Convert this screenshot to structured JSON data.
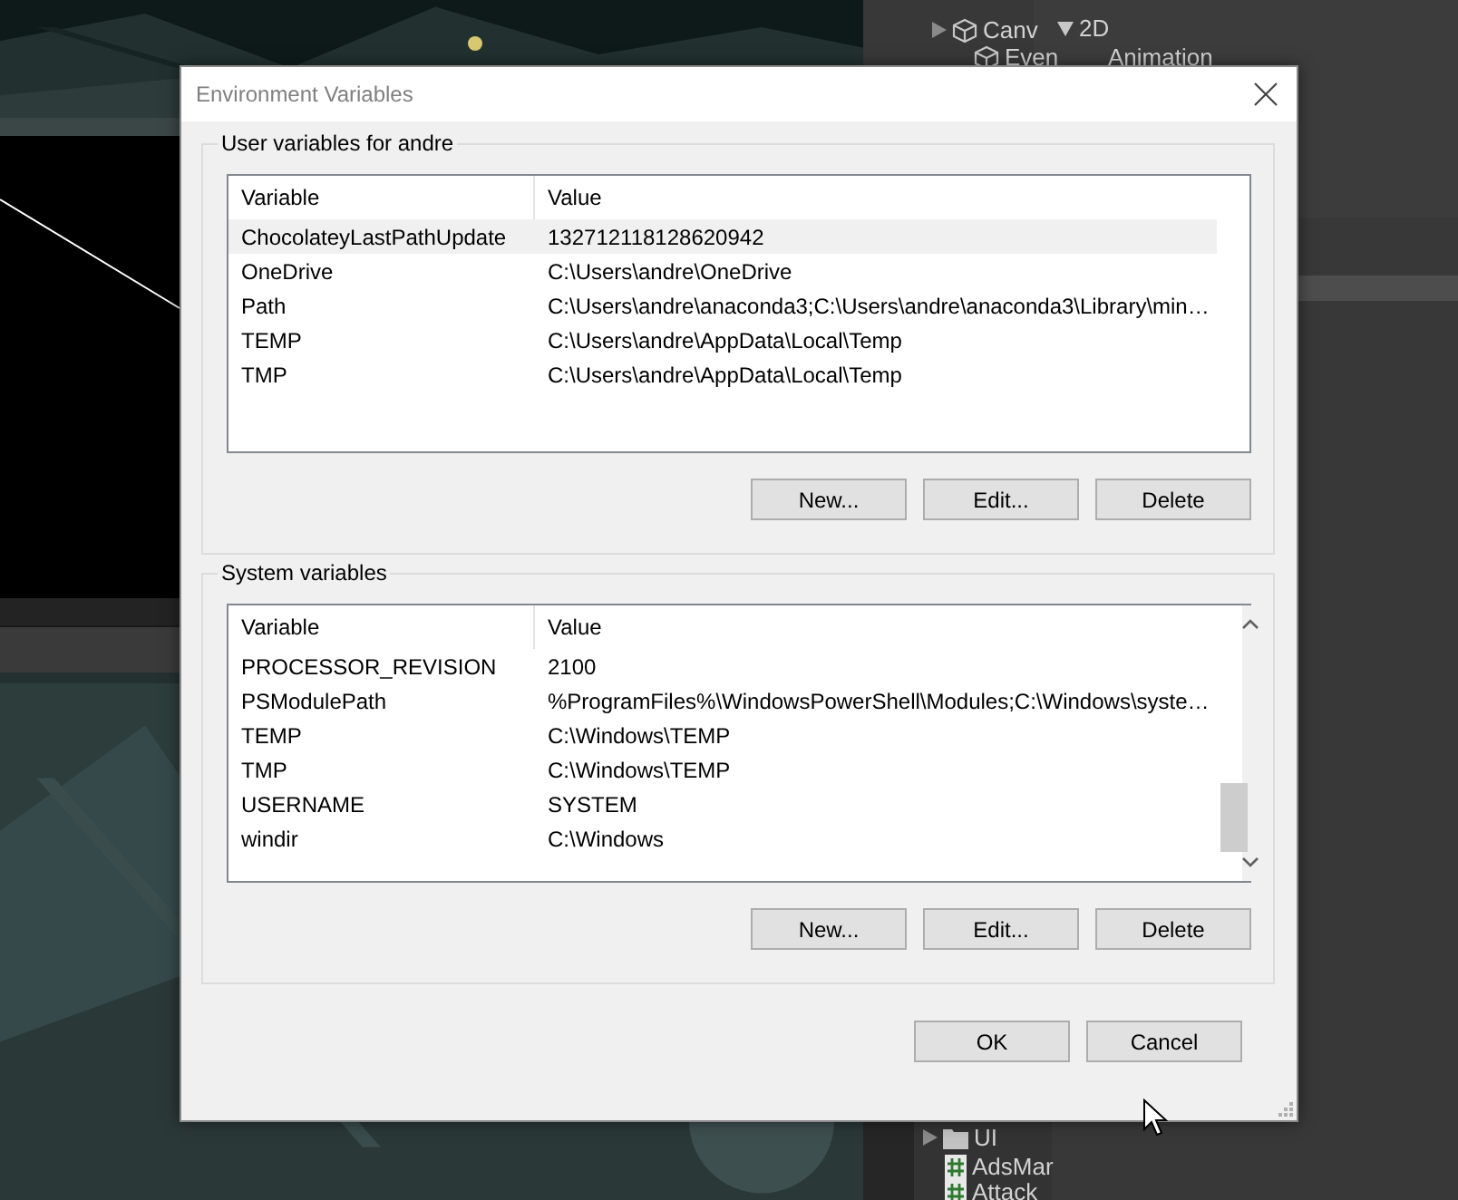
{
  "editor": {
    "hierarchy": [
      {
        "label": "Canv",
        "expanded": false
      },
      {
        "label": "Even"
      }
    ],
    "inspector": [
      {
        "label": "2D",
        "expanded": true
      },
      {
        "label": "Animation"
      }
    ],
    "project": [
      {
        "label": "UI",
        "kind": "folder"
      },
      {
        "label": "AdsMar",
        "kind": "script"
      },
      {
        "label": "Attack",
        "kind": "script"
      }
    ]
  },
  "dialog": {
    "title": "Environment Variables",
    "groups": [
      {
        "title": "User variables for andre",
        "columns": [
          "Variable",
          "Value"
        ],
        "scrollbar": false,
        "rows": [
          {
            "name": "ChocolateyLastPathUpdate",
            "value": "132712118128620942",
            "selected": true
          },
          {
            "name": "OneDrive",
            "value": "C:\\Users\\andre\\OneDrive",
            "selected": false
          },
          {
            "name": "Path",
            "value": "C:\\Users\\andre\\anaconda3;C:\\Users\\andre\\anaconda3\\Library\\min…",
            "selected": false
          },
          {
            "name": "TEMP",
            "value": "C:\\Users\\andre\\AppData\\Local\\Temp",
            "selected": false
          },
          {
            "name": "TMP",
            "value": "C:\\Users\\andre\\AppData\\Local\\Temp",
            "selected": false
          }
        ],
        "buttons": [
          "New...",
          "Edit...",
          "Delete"
        ]
      },
      {
        "title": "System variables",
        "columns": [
          "Variable",
          "Value"
        ],
        "scrollbar": true,
        "rows": [
          {
            "name": "PROCESSOR_REVISION",
            "value": "2100",
            "selected": false
          },
          {
            "name": "PSModulePath",
            "value": "%ProgramFiles%\\WindowsPowerShell\\Modules;C:\\Windows\\syste…",
            "selected": false
          },
          {
            "name": "TEMP",
            "value": "C:\\Windows\\TEMP",
            "selected": false
          },
          {
            "name": "TMP",
            "value": "C:\\Windows\\TEMP",
            "selected": false
          },
          {
            "name": "USERNAME",
            "value": "SYSTEM",
            "selected": false
          },
          {
            "name": "windir",
            "value": "C:\\Windows",
            "selected": false
          }
        ],
        "buttons": [
          "New...",
          "Edit...",
          "Delete"
        ]
      }
    ],
    "buttons": [
      "OK",
      "Cancel"
    ]
  }
}
